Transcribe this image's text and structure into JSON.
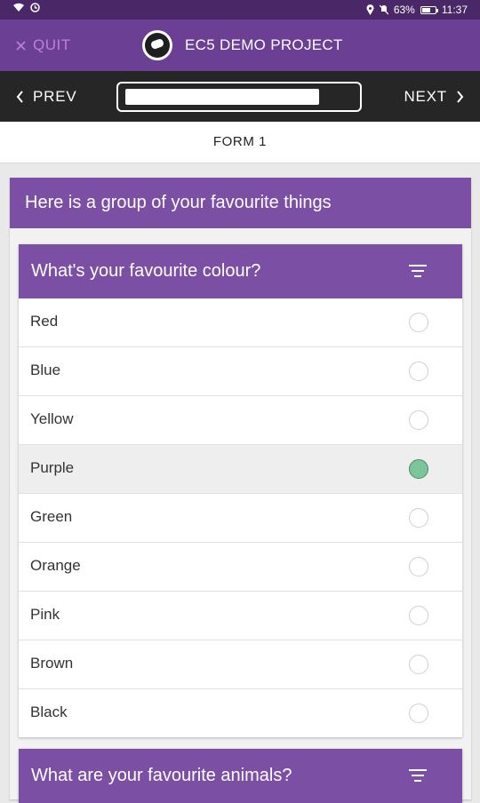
{
  "status_bar": {
    "battery": "63%",
    "time": "11:37",
    "battery_level": 0.63
  },
  "app_bar": {
    "quit_label": "QUIT",
    "title": "EC5 DEMO PROJECT"
  },
  "nav": {
    "prev_label": "PREV",
    "next_label": "NEXT",
    "progress": 0.85
  },
  "form": {
    "title": "FORM 1"
  },
  "group": {
    "title": "Here is a group of your favourite things",
    "questions": [
      {
        "title": "What's your favourite colour?",
        "options": [
          {
            "label": "Red",
            "selected": false
          },
          {
            "label": "Blue",
            "selected": false
          },
          {
            "label": "Yellow",
            "selected": false
          },
          {
            "label": "Purple",
            "selected": true
          },
          {
            "label": "Green",
            "selected": false
          },
          {
            "label": "Orange",
            "selected": false
          },
          {
            "label": "Pink",
            "selected": false
          },
          {
            "label": "Brown",
            "selected": false
          },
          {
            "label": "Black",
            "selected": false
          }
        ]
      },
      {
        "title": "What are your favourite animals?"
      }
    ]
  },
  "colors": {
    "header_purple": "#6b3f93",
    "card_purple": "#7b4fa3",
    "selected_radio": "#7cc59b",
    "nav_bg": "#262626"
  }
}
